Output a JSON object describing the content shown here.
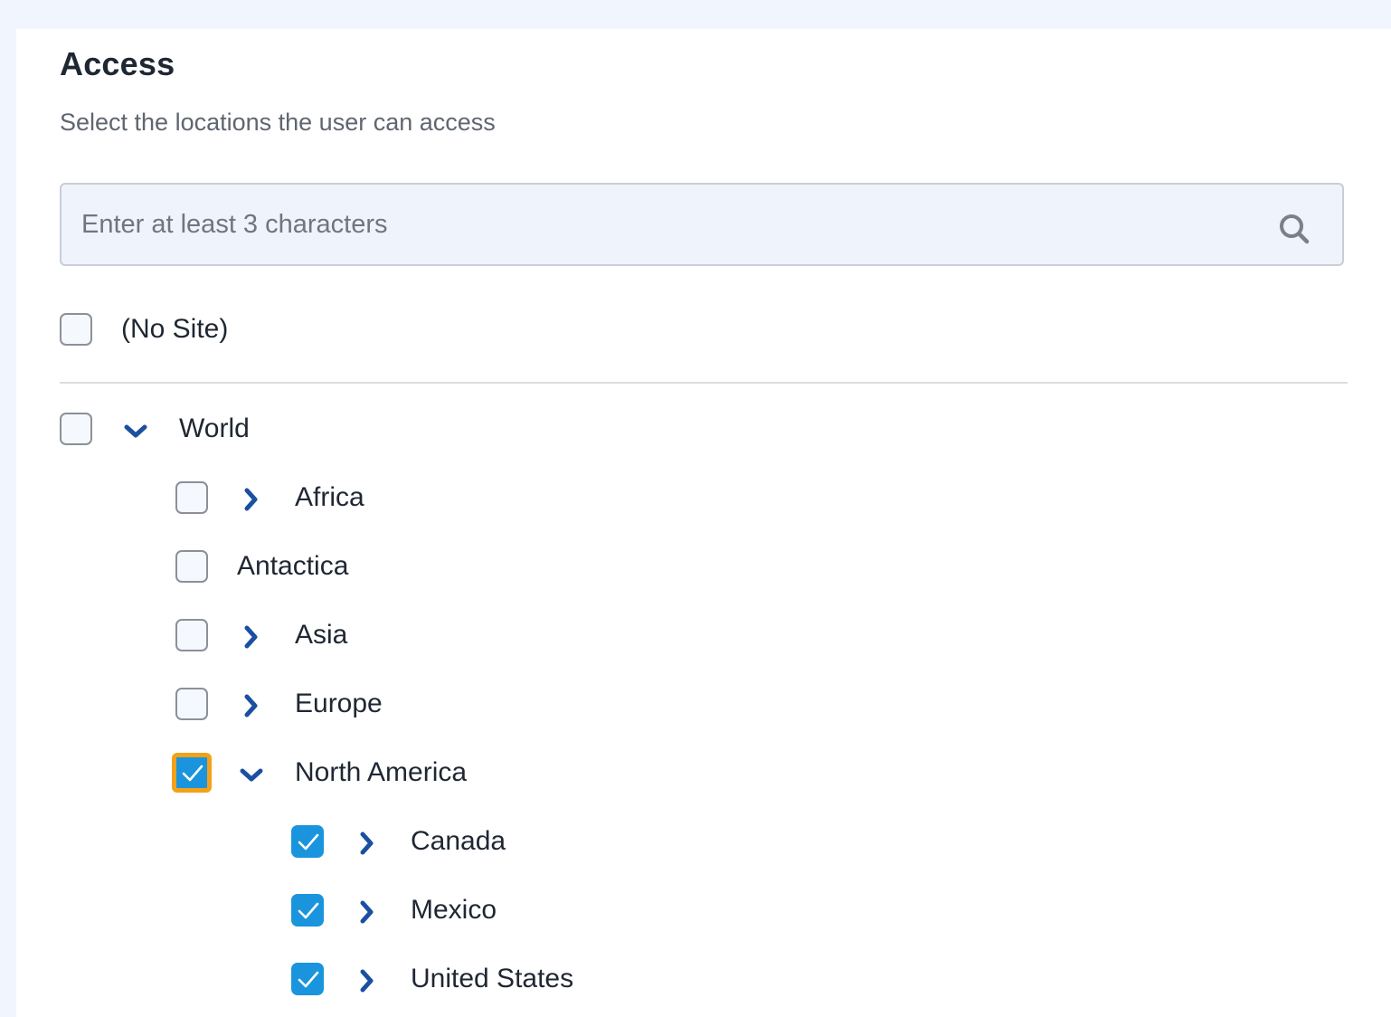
{
  "header": {
    "title": "Access",
    "subtitle": "Select the locations the user can access"
  },
  "search": {
    "placeholder": "Enter at least 3 characters",
    "value": "",
    "icon": "search-icon"
  },
  "colors": {
    "checkbox_checked": "#1a95dd",
    "focus_outline": "#f4a11a",
    "chevron": "#1b4fa0"
  },
  "no_site": {
    "label": "(No Site)",
    "checked": false
  },
  "tree": {
    "world": {
      "label": "World",
      "checked": false,
      "expanded": true
    },
    "africa": {
      "label": "Africa",
      "checked": false,
      "expanded": false
    },
    "antarctica": {
      "label": "Antactica",
      "checked": false
    },
    "asia": {
      "label": "Asia",
      "checked": false,
      "expanded": false
    },
    "europe": {
      "label": "Europe",
      "checked": false,
      "expanded": false
    },
    "north_america": {
      "label": "North America",
      "checked": true,
      "expanded": true,
      "focused": true
    },
    "canada": {
      "label": "Canada",
      "checked": true,
      "expanded": false
    },
    "mexico": {
      "label": "Mexico",
      "checked": true,
      "expanded": false
    },
    "united_states": {
      "label": "United States",
      "checked": true,
      "expanded": false
    }
  }
}
